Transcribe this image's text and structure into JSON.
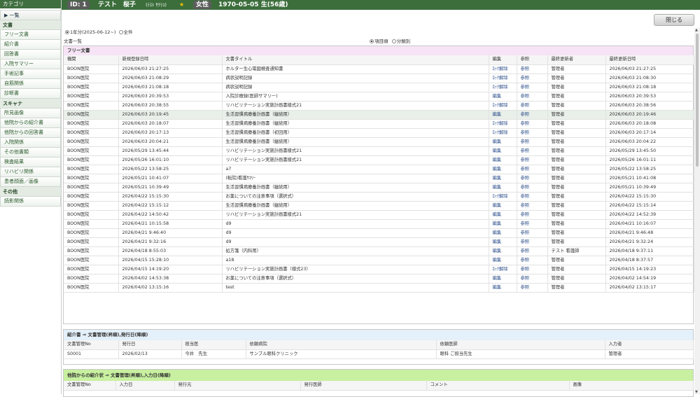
{
  "sidebar": {
    "title": "カテゴリ",
    "toggle": "▶ 一覧",
    "groups": [
      {
        "label": "文書",
        "items": [
          "フリー文書",
          "紹介書",
          "回答書",
          "入院サマリー",
          "手術記事",
          "自筋関係",
          "診断書"
        ]
      },
      {
        "label": "スキャナ",
        "items": [
          "所見画像",
          "他院からの紹介書",
          "他院からの回答書",
          "入院関係",
          "その他書類",
          "検査結果",
          "リハビリ関係",
          "患者顔面／画像"
        ]
      },
      {
        "label": "その他",
        "items": [
          "読影関係"
        ]
      }
    ]
  },
  "patient": {
    "id": "ID: 1",
    "name": "テスト　桜子",
    "kana": "(ﾃｽﾄ ｻｸﾗｺ)",
    "star": "★",
    "sex": "女性",
    "birth": "1970-05-05 生(56歳)"
  },
  "close_label": "閉じる",
  "period": {
    "opt1": "1年分(2025-06-12~)",
    "opt2": "全件"
  },
  "doclist_label": "文書一覧",
  "sort": {
    "opt1": "項目順",
    "opt2": "分類別"
  },
  "free_docs": {
    "title": "フリー文書",
    "headers": [
      "機関",
      "新規登録日時",
      "文書タイトル",
      "編集",
      "参照",
      "最終更新者",
      "最終更新日時"
    ],
    "rows": [
      [
        "BOON医院",
        "2026/06/03 21:27:25",
        "ホルター生心電図検査通知書",
        "ﾛｯｸ解除",
        "参照",
        "管理者",
        "2026/06/03 21:27:25"
      ],
      [
        "BOON医院",
        "2026/06/03 21:08:29",
        "病状説明記録",
        "ﾛｯｸ解除",
        "参照",
        "管理者",
        "2026/06/03 21:08:30"
      ],
      [
        "BOON医院",
        "2026/06/03 21:08:18",
        "病状説明記録",
        "ﾛｯｸ解除",
        "参照",
        "管理者",
        "2026/06/03 21:08:18"
      ],
      [
        "BOON医院",
        "2026/06/03 20:39:53",
        "入院診療録(医師サマリー)",
        "編集",
        "参照",
        "管理者",
        "2026/06/03 20:39:53"
      ],
      [
        "BOON医院",
        "2026/06/03 20:38:55",
        "リハビリテーション実施計画書様式21",
        "ﾛｯｸ解除",
        "参照",
        "管理者",
        "2026/06/03 20:38:56"
      ],
      [
        "BOON医院",
        "2026/06/03 20:19:45",
        "生活習慣病療養計画書（継続用）",
        "編集",
        "参照",
        "管理者",
        "2026/06/03 20:19:46"
      ],
      [
        "BOON医院",
        "2026/06/03 20:18:07",
        "生活習慣病療養計画書（継続用）",
        "ﾛｯｸ解除",
        "参照",
        "管理者",
        "2026/06/03 20:18:08"
      ],
      [
        "BOON医院",
        "2026/06/03 20:17:13",
        "生活習慣病療養計画書（初回用）",
        "ﾛｯｸ解除",
        "参照",
        "管理者",
        "2026/06/03 20:17:14"
      ],
      [
        "BOON医院",
        "2026/06/03 20:04:21",
        "生活習慣病療養計画書（継続用）",
        "編集",
        "参照",
        "管理者",
        "2026/06/03 20:04:22"
      ],
      [
        "BOON医院",
        "2026/05/29 13:45:44",
        "リハビリテーション実施計画書様式21",
        "編集",
        "参照",
        "管理者",
        "2026/05/29 13:45:50"
      ],
      [
        "BOON医院",
        "2026/05/26 16:01:10",
        "リハビリテーション実施計画書様式21",
        "編集",
        "参照",
        "管理者",
        "2026/05/26 16:01:11"
      ],
      [
        "BOON医院",
        "2026/05/22 13:58:25",
        "a7",
        "編集",
        "参照",
        "管理者",
        "2026/05/22 13:58:25"
      ],
      [
        "BOON医院",
        "2026/05/21 10:41:07",
        "(転院)看護ｻﾏﾘｰ",
        "編集",
        "参照",
        "管理者",
        "2026/05/21 10:41:08"
      ],
      [
        "BOON医院",
        "2026/05/21 10:39:49",
        "生活習慣病療養計画書（継続用）",
        "編集",
        "参照",
        "管理者",
        "2026/05/21 10:39:49"
      ],
      [
        "BOON医院",
        "2026/04/22 15:15:30",
        "お薬についての注意事項（選択式）",
        "ﾛｯｸ解除",
        "参照",
        "管理者",
        "2026/04/22 15:15:30"
      ],
      [
        "BOON医院",
        "2026/04/22 15:15:12",
        "生活習慣病療養計画書（継続用）",
        "編集",
        "参照",
        "管理者",
        "2026/04/22 15:15:14"
      ],
      [
        "BOON医院",
        "2026/04/22 14:50:42",
        "リハビリテーション実施計画書様式21",
        "編集",
        "参照",
        "管理者",
        "2026/04/22 14:52:39"
      ],
      [
        "BOON医院",
        "2026/04/21 10:15:58",
        "d9",
        "編集",
        "参照",
        "管理者",
        "2026/04/21 10:16:07"
      ],
      [
        "BOON医院",
        "2026/04/21 9:46:40",
        "d9",
        "編集",
        "参照",
        "管理者",
        "2026/04/21 9:46:48"
      ],
      [
        "BOON医院",
        "2026/04/21 9:32:16",
        "d9",
        "編集",
        "参照",
        "管理者",
        "2026/04/21 9:32:24"
      ],
      [
        "BOON医院",
        "2026/04/18 8:55:03",
        "処方箋（内科用）",
        "編集",
        "参照",
        "テスト 看護師",
        "2026/04/18 9:37:11"
      ],
      [
        "BOON医院",
        "2026/04/15 15:28:10",
        "a18",
        "編集",
        "参照",
        "管理者",
        "2026/04/18 8:37:57"
      ],
      [
        "BOON医院",
        "2026/04/15 14:19:20",
        "リハビリテーション実施計画書（様式23）",
        "ﾛｯｸ解除",
        "参照",
        "管理者",
        "2026/04/15 14:19:23"
      ],
      [
        "BOON医院",
        "2026/04/02 14:53:38",
        "お薬についての注意事項（選択式）",
        "編集",
        "参照",
        "管理者",
        "2026/04/02 14:54:19"
      ],
      [
        "BOON医院",
        "2026/04/02 13:15:16",
        "test",
        "編集",
        "参照",
        "管理者",
        "2026/04/02 13:15:17"
      ]
    ]
  },
  "referral": {
    "title": "紹介書 ⇒ 文書管理(昇順),発行日(降順)",
    "headers": [
      "文書管理No",
      "発行日",
      "担当医",
      "依頼病院",
      "依頼医師",
      "入力者"
    ],
    "rows": [
      [
        "S0001",
        "2026/02/13",
        "今井　先生",
        "サンプル眼科クリニック",
        "眼科 ご担当先生",
        "管理者"
      ]
    ]
  },
  "other_referral": {
    "title": "他院からの紹介状 ⇒ 文書管理(昇順),入力日(降順)",
    "headers": [
      "文書管理No",
      "入力日",
      "発行元",
      "発行医師",
      "コメント",
      "画像"
    ]
  },
  "colors": {
    "header": "#3c6e3c",
    "free_docs_title": "#f6e4f6",
    "referral_title": "#e4f0fa",
    "other_title": "#c8f0a0"
  }
}
